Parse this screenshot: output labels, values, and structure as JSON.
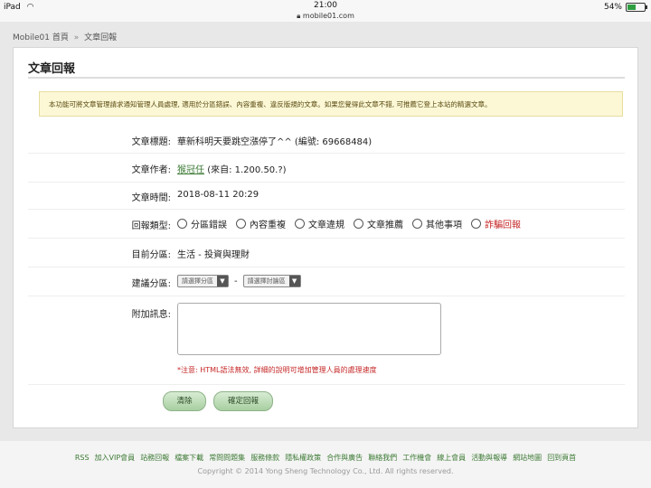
{
  "statusbar": {
    "device": "iPad",
    "time": "21:00",
    "url": "mobile01.com",
    "battery": "54%",
    "battery_level": 0.54
  },
  "breadcrumb": {
    "home": "Mobile01 首頁",
    "separator": "»",
    "current": "文章回報"
  },
  "page": {
    "title": "文章回報",
    "notice": "本功能可將文章管理請求通知管理人員處理, 適用於分區錯誤、內容重複、違反版規的文章。如果您覺得此文章不錯, 可推薦它登上本站的精選文章。"
  },
  "form": {
    "article_title_label": "文章標題:",
    "article_title_value": "華新科明天要跳空漲停了^^ (編號: 69668484)",
    "author_label": "文章作者:",
    "author_name": "猴冠任",
    "author_from": "(來自: 1.200.50.?)",
    "time_label": "文章時間:",
    "time_value": "2018-08-11 20:29",
    "report_type_label": "回報類型:",
    "report_types": [
      "分區錯誤",
      "內容重複",
      "文章違規",
      "文章推薦",
      "其他事項",
      "詐騙回報"
    ],
    "current_section_label": "目前分區:",
    "current_section_value": "生活 - 投資與理財",
    "suggest_label": "建議分區:",
    "select_category_placeholder": "請選擇分區",
    "select_forum_placeholder": "請選擇討論區",
    "dash": "-",
    "message_label": "附加訊息:",
    "warning": "*注意: HTML語法無效, 詳細的說明可增加管理人員的處理速度",
    "clear_button": "清除",
    "submit_button": "確定回報"
  },
  "footer": {
    "links": [
      "RSS",
      "加入VIP會員",
      "站務回報",
      "檔案下載",
      "常問問題集",
      "服務條款",
      "隱私權政策",
      "合作與廣告",
      "聯絡我們",
      "工作機會",
      "線上會員",
      "活動與報導",
      "網站地圖",
      "回到頁首"
    ],
    "copyright": "Copyright © 2014 Yong Sheng Technology Co., Ltd. All rights reserved."
  }
}
